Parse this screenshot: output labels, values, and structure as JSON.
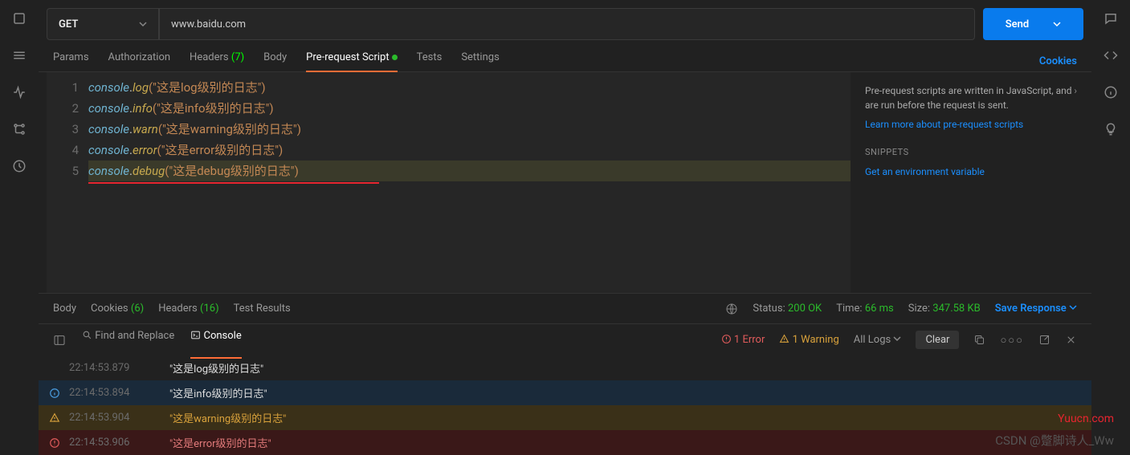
{
  "request": {
    "method": "GET",
    "url": "www.baidu.com",
    "send_label": "Send"
  },
  "tabs": {
    "params": "Params",
    "auth": "Authorization",
    "headers": "Headers",
    "headers_count": "(7)",
    "body": "Body",
    "prereq": "Pre-request Script",
    "tests": "Tests",
    "settings": "Settings",
    "cookies": "Cookies"
  },
  "editor": {
    "lines": [
      {
        "n": "1",
        "method": "log",
        "str": "\"这是log级别的日志\""
      },
      {
        "n": "2",
        "method": "info",
        "str": "\"这是info级别的日志\""
      },
      {
        "n": "3",
        "method": "warn",
        "str": "\"这是warning级别的日志\""
      },
      {
        "n": "4",
        "method": "error",
        "str": "\"这是error级别的日志\""
      },
      {
        "n": "5",
        "method": "debug",
        "str": "\"这是debug级别的日志\""
      }
    ],
    "obj": "console"
  },
  "help": {
    "text": "Pre-request scripts are written in JavaScript, and are run before the request is sent.",
    "link": "Learn more about pre-request scripts",
    "snippets_title": "SNIPPETS",
    "snippet1": "Get an environment variable"
  },
  "response_tabs": {
    "body": "Body",
    "cookies": "Cookies",
    "cookies_count": "(6)",
    "headers": "Headers",
    "headers_count": "(16)",
    "tests": "Test Results"
  },
  "response_meta": {
    "status_label": "Status:",
    "status_value": "200 OK",
    "time_label": "Time:",
    "time_value": "66 ms",
    "size_label": "Size:",
    "size_value": "347.58 KB",
    "save": "Save Response"
  },
  "bottom": {
    "find": "Find and Replace",
    "console": "Console",
    "errors": "1 Error",
    "warnings": "1 Warning",
    "filter": "All Logs",
    "clear": "Clear"
  },
  "logs": [
    {
      "ts": "22:14:53.879",
      "level": "log",
      "msg": "\"这是log级别的日志\""
    },
    {
      "ts": "22:14:53.894",
      "level": "info",
      "msg": "\"这是info级别的日志\""
    },
    {
      "ts": "22:14:53.904",
      "level": "warn",
      "msg": "\"这是warning级别的日志\""
    },
    {
      "ts": "22:14:53.906",
      "level": "error",
      "msg": "\"这是error级别的日志\""
    }
  ],
  "watermark1": "Yuucn.com",
  "watermark2": "CSDN @蹩脚诗人_Ww"
}
